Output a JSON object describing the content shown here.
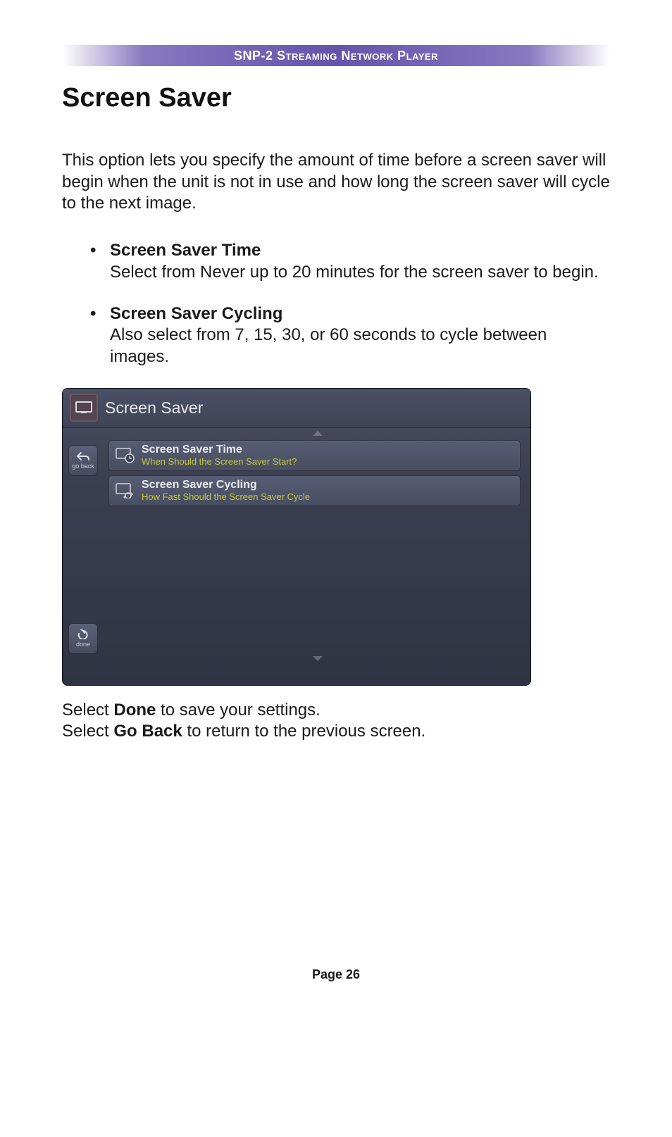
{
  "header": {
    "title": "SNP-2 Streaming Network Player"
  },
  "section_title": "Screen Saver",
  "intro": "This option lets you specify the amount of time before a screen saver will begin when the unit is not in use and how long the screen saver will cycle to the next image.",
  "bullets": [
    {
      "title": "Screen Saver Time",
      "desc": "Select from Never up to 20 minutes for the screen saver to begin."
    },
    {
      "title": "Screen Saver Cycling",
      "desc": "Also select from 7, 15, 30, or 60 seconds to cycle between images."
    }
  ],
  "screenshot": {
    "title": "Screen Saver",
    "sidebar": {
      "back_label": "go back",
      "done_label": "done"
    },
    "items": [
      {
        "title": "Screen Saver Time",
        "subtitle": "When Should the Screen Saver Start?"
      },
      {
        "title": "Screen Saver Cycling",
        "subtitle": "How Fast Should the Screen Saver Cycle"
      }
    ]
  },
  "post": {
    "line1_pre": "Select ",
    "line1_bold": "Done",
    "line1_post": " to save your settings.",
    "line2_pre": "Select ",
    "line2_bold": "Go Back",
    "line2_post": " to return to the previous screen."
  },
  "footer": {
    "page_label": "Page 26"
  }
}
